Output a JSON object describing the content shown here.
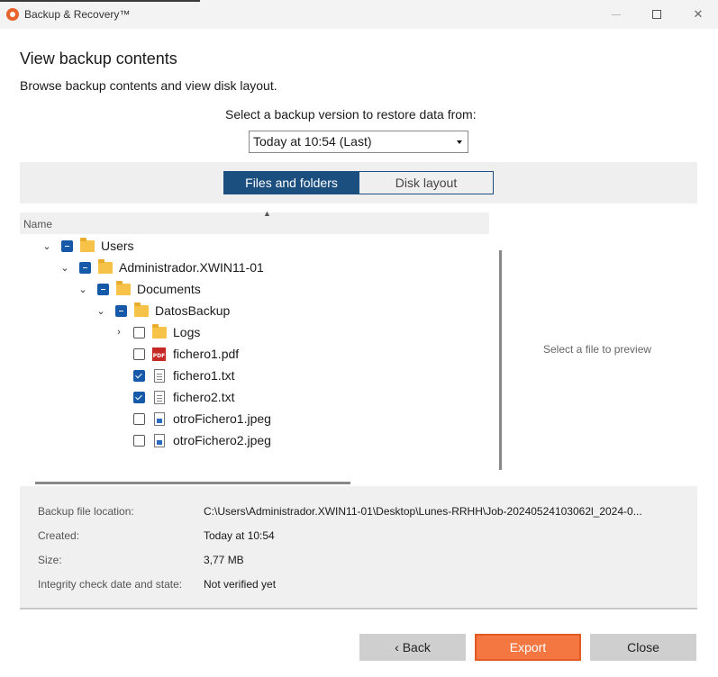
{
  "window": {
    "title": "Backup & Recovery™"
  },
  "page": {
    "title": "View backup contents",
    "subtitle": "Browse backup contents and view disk layout.",
    "select_label": "Select a backup version to restore data from:",
    "version_selected": "Today at 10:54 (Last)"
  },
  "tabs": {
    "files": "Files and folders",
    "disk": "Disk layout",
    "active": "Files and folders"
  },
  "tree": {
    "column_header": "Name",
    "items": [
      {
        "label": "Users",
        "type": "folder",
        "check": "partial",
        "expanded": true
      },
      {
        "label": "Administrador.XWIN11-01",
        "type": "folder",
        "check": "partial",
        "expanded": true
      },
      {
        "label": "Documents",
        "type": "folder",
        "check": "partial",
        "expanded": true
      },
      {
        "label": "DatosBackup",
        "type": "folder",
        "check": "partial",
        "expanded": true
      },
      {
        "label": "Logs",
        "type": "folder",
        "check": "unchecked",
        "expanded": false
      },
      {
        "label": "fichero1.pdf",
        "type": "pdf",
        "check": "unchecked"
      },
      {
        "label": "fichero1.txt",
        "type": "txt",
        "check": "checked"
      },
      {
        "label": "fichero2.txt",
        "type": "txt",
        "check": "checked"
      },
      {
        "label": "otroFichero1.jpeg",
        "type": "image",
        "check": "unchecked"
      },
      {
        "label": "otroFichero2.jpeg",
        "type": "image",
        "check": "unchecked"
      }
    ],
    "pdf_icon_text": "PDF"
  },
  "preview": {
    "hint": "Select a file to preview"
  },
  "info": {
    "location_label": "Backup file location:",
    "location_value": "C:\\Users\\Administrador.XWIN11-01\\Desktop\\Lunes-RRHH\\Job-20240524103062l_2024-0...",
    "created_label": "Created:",
    "created_value": "Today at 10:54",
    "size_label": "Size:",
    "size_value": "3,77 MB",
    "integrity_label": "Integrity check date and state:",
    "integrity_value": "Not verified yet"
  },
  "buttons": {
    "back": "‹ Back",
    "export": "Export",
    "close": "Close"
  },
  "colors": {
    "accent": "#1b4f80",
    "export": "#f47640",
    "checkbox": "#1659a8"
  }
}
